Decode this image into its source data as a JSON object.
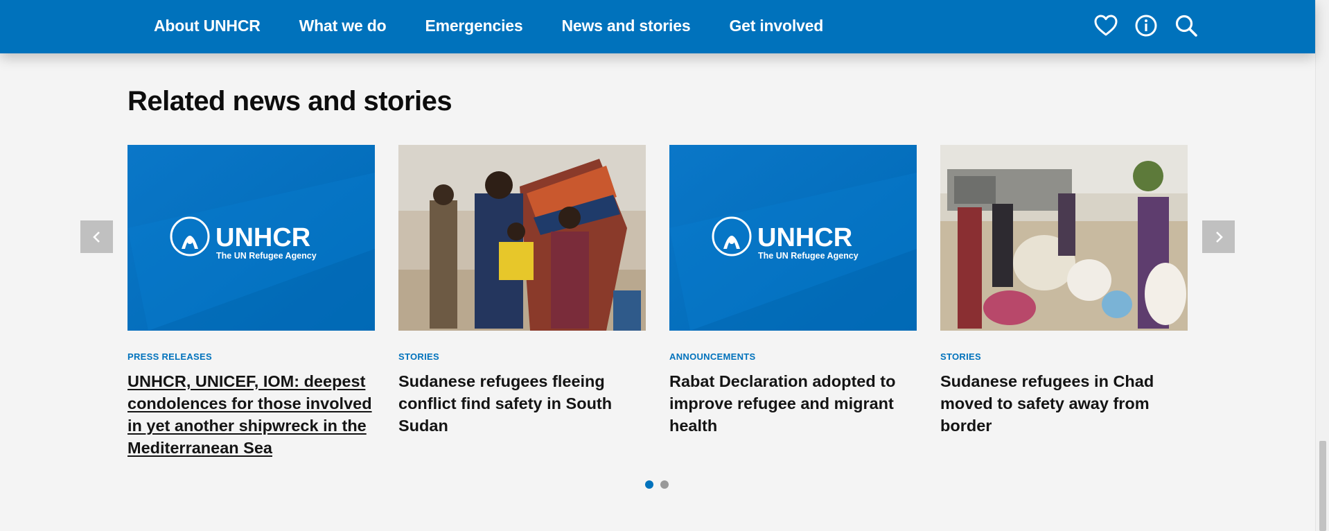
{
  "nav": {
    "items": [
      {
        "label": "About UNHCR"
      },
      {
        "label": "What we do"
      },
      {
        "label": "Emergencies"
      },
      {
        "label": "News and stories"
      },
      {
        "label": "Get involved"
      }
    ],
    "icons": [
      "heart-icon",
      "info-icon",
      "search-icon"
    ]
  },
  "section": {
    "title": "Related news and stories"
  },
  "logo": {
    "wordmark": "UNHCR",
    "tagline": "The UN Refugee Agency"
  },
  "cards": [
    {
      "tag": "PRESS RELEASES",
      "title": "UNHCR, UNICEF, IOM: deepest condolences for those involved in yet another shipwreck in the Mediterranean Sea",
      "image": "unhcr-logo"
    },
    {
      "tag": "STORIES",
      "title": "Sudanese refugees fleeing conflict find safety in South Sudan",
      "image": "photo-family"
    },
    {
      "tag": "ANNOUNCEMENTS",
      "title": "Rabat Declaration adopted to improve refugee and migrant health",
      "image": "unhcr-logo"
    },
    {
      "tag": "STORIES",
      "title": "Sudanese refugees in Chad moved to safety away from border",
      "image": "photo-crowd"
    }
  ],
  "carousel": {
    "pages": 2,
    "active_page": 1
  },
  "colors": {
    "brand_blue": "#0072bc",
    "page_bg": "#f4f4f4",
    "arrow_bg": "#c0c0c0"
  }
}
